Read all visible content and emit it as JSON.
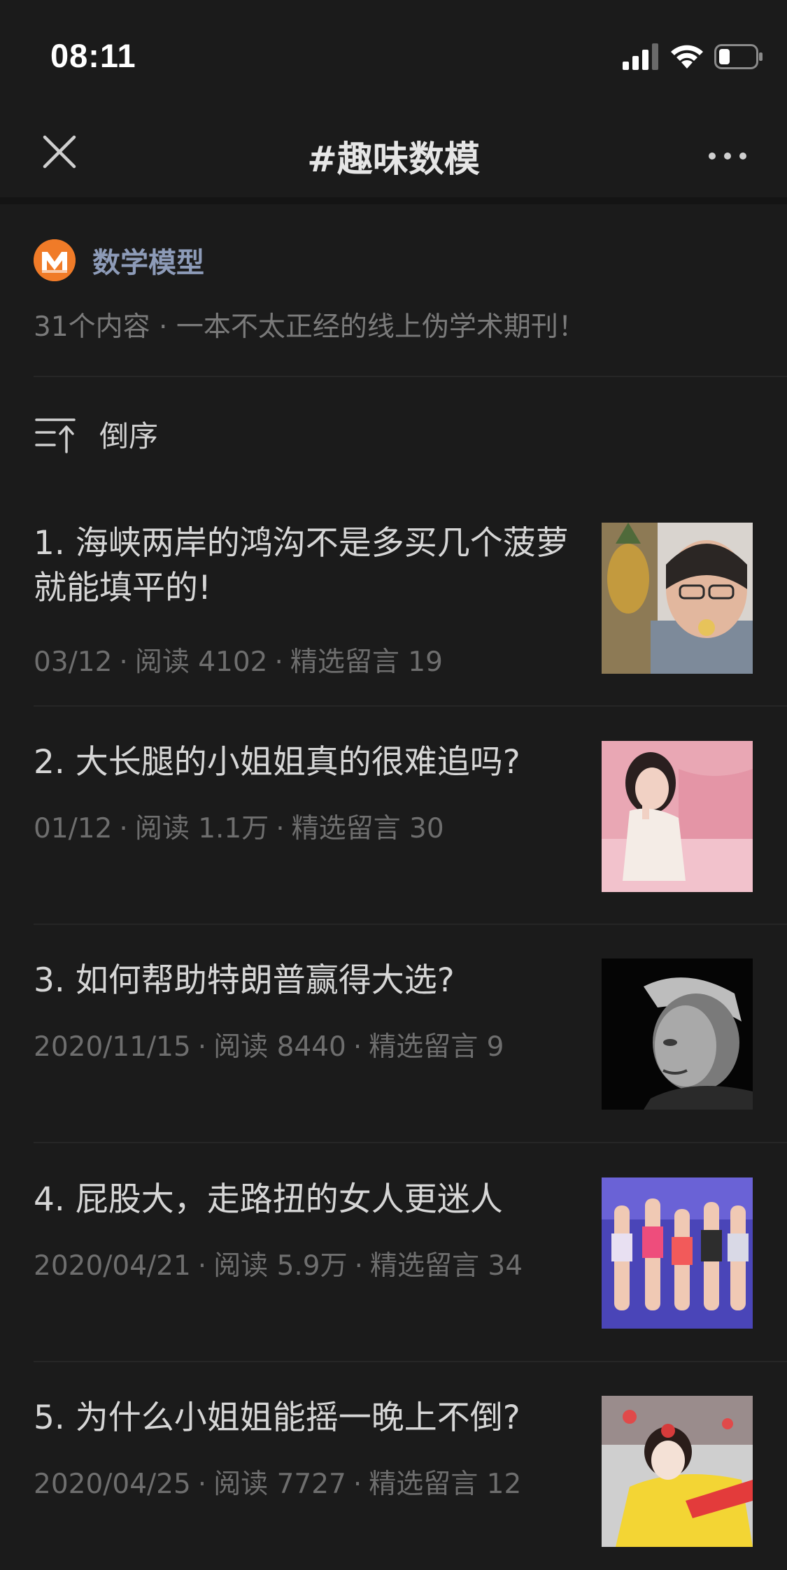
{
  "status_bar": {
    "time": "08:11"
  },
  "nav": {
    "title": "#趣味数模"
  },
  "account": {
    "name": "数学模型",
    "description": "31个内容 · 一本不太正经的线上伪学术期刊！"
  },
  "sort": {
    "label": "倒序"
  },
  "articles": [
    {
      "title": "1. 海峡两岸的鸿沟不是多买几个菠萝就能填平的!",
      "date": "03/12",
      "reads": "阅读 4102",
      "comments": "精选留言 19",
      "thumb": "woman-eating-pineapple-photo"
    },
    {
      "title": "2. 大长腿的小姐姐真的很难追吗?",
      "date": "01/12",
      "reads": "阅读 1.1万",
      "comments": "精选留言 30",
      "thumb": "woman-on-pink-bed-photo"
    },
    {
      "title": "3. 如何帮助特朗普赢得大选?",
      "date": "2020/11/15",
      "reads": "阅读 8440",
      "comments": "精选留言 9",
      "thumb": "black-white-portrait-photo"
    },
    {
      "title": "4. 屁股大，走路扭的女人更迷人",
      "date": "2020/04/21",
      "reads": "阅读 5.9万",
      "comments": "精选留言 34",
      "thumb": "runway-models-photo"
    },
    {
      "title": "5. 为什么小姐姐能摇一晚上不倒?",
      "date": "2020/04/25",
      "reads": "阅读 7727",
      "comments": "精选留言 12",
      "thumb": "performer-in-costume-photo"
    }
  ],
  "colors": {
    "background": "#1b1b1b",
    "account_name": "#8d9bb8",
    "avatar": "#f07b28",
    "meta_text": "#6e6e6e"
  }
}
